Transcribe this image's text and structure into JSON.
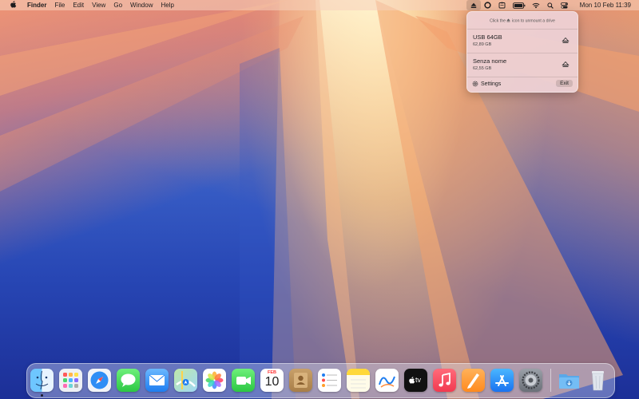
{
  "menubar": {
    "app_name": "Finder",
    "menus": [
      "File",
      "Edit",
      "View",
      "Go",
      "Window",
      "Help"
    ],
    "clock": "Mon 10 Feb  11:39",
    "status_icons": [
      "eject-icon",
      "sync-icon",
      "clipboard-icon",
      "battery-icon",
      "wifi-icon",
      "search-icon",
      "control-center-icon"
    ]
  },
  "popover": {
    "hint_before": "Click the",
    "hint_after": "icon to unmount a drive",
    "drives": [
      {
        "name": "USB 64GB",
        "size": "62,89 GB"
      },
      {
        "name": "Senza nome",
        "size": "62,55 GB"
      }
    ],
    "settings_label": "Settings",
    "exit_label": "Exit"
  },
  "dock": {
    "calendar_month": "FEB",
    "calendar_day": "10",
    "tv_label": "tv",
    "apps": [
      "Finder",
      "Launchpad",
      "Safari",
      "Messages",
      "Mail",
      "Maps",
      "Photos",
      "FaceTime",
      "Calendar",
      "Contacts",
      "Reminders",
      "Notes",
      "Freeform",
      "TV",
      "Music",
      "Pages",
      "App Store",
      "System Settings",
      "Downloads",
      "Trash"
    ]
  },
  "colors": {
    "accent_blue": "#1e88f5",
    "menubar_bg": "#f5d2be",
    "popover_bg": "#eed2d6"
  }
}
